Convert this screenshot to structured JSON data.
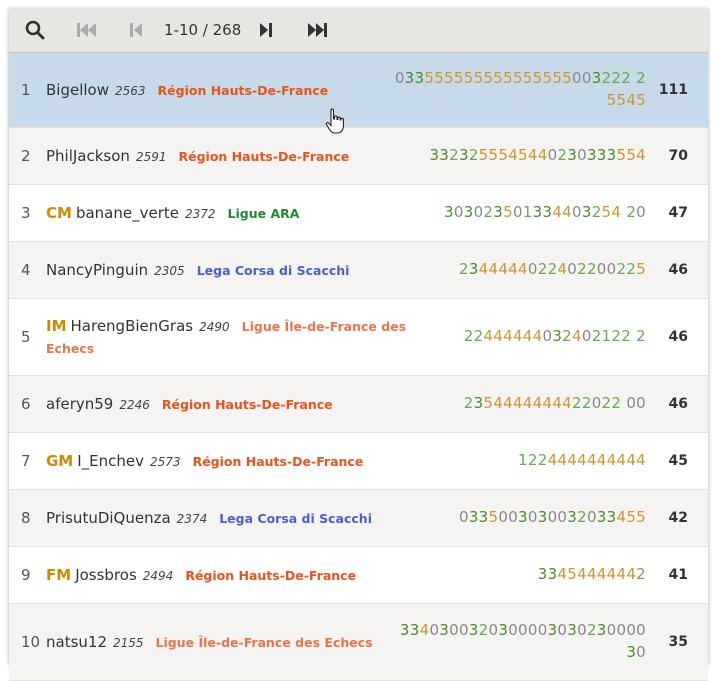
{
  "toolbar": {
    "page_info": "1-10 / 268",
    "icons": [
      "search-icon",
      "first-page-icon",
      "prev-page-icon",
      "next-page-icon",
      "last-page-icon"
    ]
  },
  "colors": {
    "hauts_de_france": "#e8541b",
    "ara": "#1f8a2e",
    "corse": "#4a5fd0",
    "ile_de_france": "#e8754b",
    "title": "#d48800",
    "highlight": "#c6daea"
  },
  "rows": [
    {
      "rank": "1",
      "title": "",
      "name": "Bigellow",
      "rating": "2563",
      "team": "Région Hauts-De-France",
      "team_color": "#e8541b",
      "scores": "033555555555555555003222 25545",
      "total": "111"
    },
    {
      "rank": "2",
      "title": "",
      "name": "PhilJackson",
      "rating": "2591",
      "team": "Région Hauts-De-France",
      "team_color": "#e8541b",
      "scores": "3323255545440230333554",
      "total": "70"
    },
    {
      "rank": "3",
      "title": "CM",
      "name": "banane_verte",
      "rating": "2372",
      "team": "Ligue ARA",
      "team_color": "#1f8a2e",
      "scores": "303023501334403254 20",
      "total": "47"
    },
    {
      "rank": "4",
      "title": "",
      "name": "NancyPinguin",
      "rating": "2305",
      "team": "Lega Corsa di Scacchi",
      "team_color": "#4a5fd0",
      "scores": "2344444022402200225",
      "total": "46"
    },
    {
      "rank": "5",
      "title": "IM",
      "name": "HarengBienGras",
      "rating": "2490",
      "team": "Ligue Île-de-France des Echecs",
      "team_color": "#e8754b",
      "scores": "22444444032402122 2",
      "total": "46"
    },
    {
      "rank": "6",
      "title": "",
      "name": "aferyn59",
      "rating": "2246",
      "team": "Région Hauts-De-France",
      "team_color": "#e8541b",
      "scores": "2354444444422022 00",
      "total": "46"
    },
    {
      "rank": "7",
      "title": "GM",
      "name": "I_Enchev",
      "rating": "2573",
      "team": "Région Hauts-De-France",
      "team_color": "#e8541b",
      "scores": "1224444444444",
      "total": "45"
    },
    {
      "rank": "8",
      "title": "",
      "name": "PrisutuDiQuenza",
      "rating": "2374",
      "team": "Lega Corsa di Scacchi",
      "team_color": "#4a5fd0",
      "scores": "0335003030032033455",
      "total": "42"
    },
    {
      "rank": "9",
      "title": "FM",
      "name": "Jossbros",
      "rating": "2494",
      "team": "Région Hauts-De-France",
      "team_color": "#e8541b",
      "scores": "33454444442",
      "total": "41"
    },
    {
      "rank": "10",
      "title": "",
      "name": "natsu12",
      "rating": "2155",
      "team": "Ligue Île-de-France des Echecs",
      "team_color": "#e8754b",
      "scores": "3340300320300003030230000 30",
      "total": "35"
    }
  ]
}
